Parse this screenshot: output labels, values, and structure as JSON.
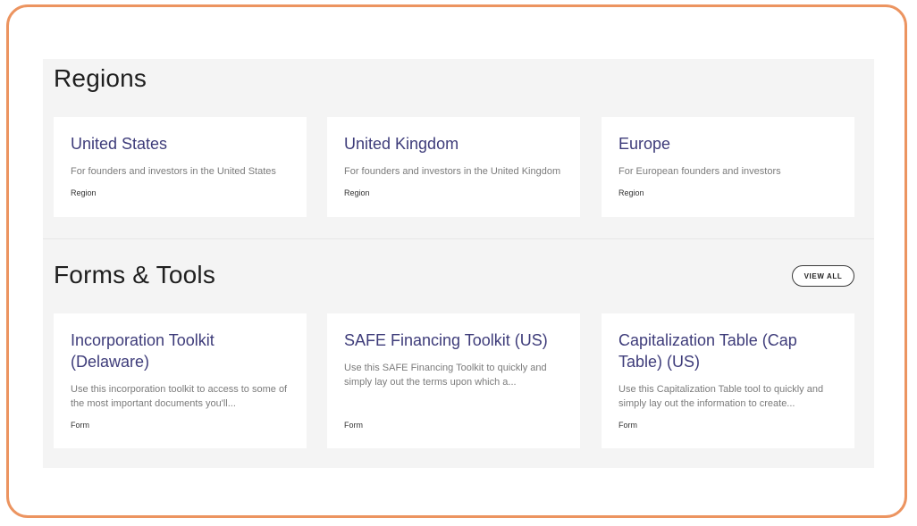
{
  "regions": {
    "title": "Regions",
    "cards": [
      {
        "title": "United States",
        "description": "For founders and investors in the United States",
        "tag": "Region"
      },
      {
        "title": "United Kingdom",
        "description": "For founders and investors in the United Kingdom",
        "tag": "Region"
      },
      {
        "title": "Europe",
        "description": "For European founders and investors",
        "tag": "Region"
      }
    ]
  },
  "forms_tools": {
    "title": "Forms & Tools",
    "view_all_label": "VIEW ALL",
    "cards": [
      {
        "title": "Incorporation Toolkit (Delaware)",
        "description": "Use this incorporation toolkit to access to some of the most important documents you'll...",
        "tag": "Form"
      },
      {
        "title": "SAFE Financing Toolkit (US)",
        "description": "Use this SAFE Financing Toolkit to quickly and simply lay out the terms upon which a...",
        "tag": "Form"
      },
      {
        "title": "Capitalization Table (Cap Table) (US)",
        "description": "Use this Capitalization Table tool to quickly and simply lay out the information to create...",
        "tag": "Form"
      }
    ]
  },
  "colors": {
    "frame_border": "#ec9460",
    "card_title": "#3e3c7a",
    "panel_bg": "#f4f4f4"
  }
}
